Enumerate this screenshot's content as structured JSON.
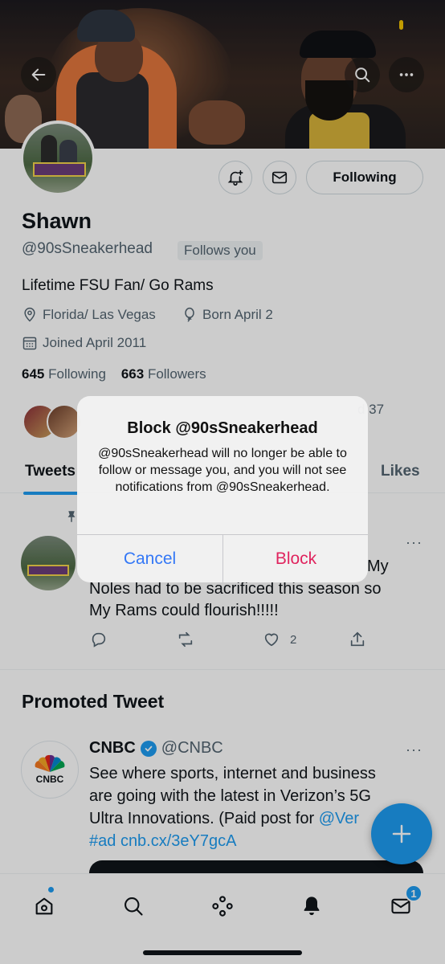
{
  "colors": {
    "accent": "#1d9bf0",
    "destructive": "#e0245e",
    "ios_blue": "#3478f6",
    "text": "#0f1419",
    "muted": "#536471"
  },
  "header": {
    "back_icon": "back-arrow-icon",
    "search_icon": "search-icon",
    "more_icon": "more-horizontal-icon"
  },
  "profile": {
    "name": "Shawn",
    "handle": "@90sSneakerhead",
    "follows_you": "Follows you",
    "bio": "Lifetime FSU Fan/ Go Rams",
    "location": "Florida/ Las Vegas",
    "birthday": "Born April 2",
    "joined": "Joined April 2011",
    "following_count": "645",
    "following_label": "Following",
    "followers_count": "663",
    "followers_label": "Followers",
    "following_button": "Following",
    "followed_by_fragment": "d 37"
  },
  "tabs": [
    {
      "label": "Tweets",
      "active": true
    },
    {
      "label": "Likes",
      "active": false
    }
  ],
  "pinned_tweet": {
    "text_fragment": "My",
    "lines": [
      "Noles had to be sacrificed this season so",
      "My Rams could flourish!!!!!"
    ],
    "like_count": "2"
  },
  "promoted": {
    "heading": "Promoted Tweet",
    "account_name": "CNBC",
    "account_handle": "@CNBC",
    "avatar_text": "CNBC",
    "lines": [
      "See where sports, internet and business",
      "are going with the latest in Verizon’s 5G",
      "Ultra Innovations. (Paid post for "
    ],
    "mention": "@Ver",
    "hashtag": "#ad",
    "link": "cnb.cx/3eY7gcA"
  },
  "dialog": {
    "title": "Block @90sSneakerhead",
    "message": "@90sSneakerhead will no longer be able to follow or message you, and you will not see notifications from @90sSneakerhead.",
    "cancel_label": "Cancel",
    "block_label": "Block"
  },
  "bottom_nav": {
    "items": [
      "home-icon",
      "search-icon",
      "spaces-icon",
      "notifications-icon",
      "messages-icon"
    ],
    "messages_badge": "1"
  }
}
